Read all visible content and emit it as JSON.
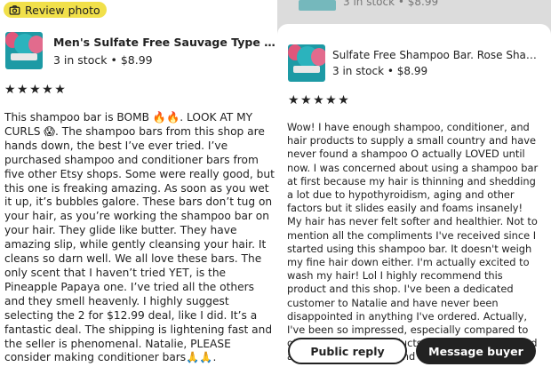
{
  "left": {
    "badge_label": "Review photo",
    "item": {
      "title": "Men's Sulfate Free Sauvage Type Shampoo Bar",
      "stock": "3 in stock",
      "price": "$8.99",
      "separator": "•"
    },
    "rating_stars": "★★★★★",
    "review_text": "This shampoo bar is BOMB 🔥🔥. LOOK AT MY CURLS 😱. The shampoo bars from this shop are hands down, the best I’ve ever tried. I’ve purchased shampoo and conditioner bars from five other Etsy shops. Some were really good, but this one is freaking amazing. As soon as you wet it up, it’s bubbles galore. These bars don’t tug on your hair, as you’re working the shampoo bar on your hair. They glide like butter. They have amazing slip, while gently cleansing your hair. It cleans so darn well. We all love these bars. The only scent that I haven’t tried YET, is the Pineapple Papaya one. I’ve tried all the others and they smell heavenly. I highly suggest selecting the 2 for $12.99 deal, like I did. It’s a fantastic deal. The shipping is lightening fast and the seller is phenomenal. Natalie, PLEASE consider making conditioner bars🙏🙏."
  },
  "right": {
    "peek_meta": "3 in stock • $8.99",
    "item": {
      "title": "Sulfate Free Shampoo Bar. Rose Shaped Shampoo Bar",
      "stock": "3 in stock",
      "price": "$8.99",
      "separator": "•"
    },
    "rating_stars": "★★★★★",
    "review_text": "Wow! I have enough shampoo, conditioner, and hair products to supply a small country and have never found a shampoo O actually LOVED until now. I was concerned about using a shampoo bar at first because my hair is thinning and shedding a lot due to hypothyroidism, aging and other factors but it slides easily and foams insanely! My hair has never felt softer and healthier. Not to mention all the compliments I've received since I started using this shampoo bar. It doesn't weigh my fine hair down either. I'm actually excited to wash my hair! Lol I highly recommend this product and this shop. I've been a dedicated customer to Natalie and have never been disappointed in anything I've ordered. Actually, I've been so impressed, especially compared to other sellers. Her products are truly one of a kind and the best you will find",
    "buttons": {
      "public_reply": "Public reply",
      "message_buyer": "Message buyer"
    }
  },
  "colors": {
    "badge": "#f1e04a",
    "button_dark": "#222222",
    "thumb_teal": "#1d9aa5",
    "thumb_pink": "#e0567b"
  },
  "icons": [
    "camera-icon",
    "star-icon"
  ]
}
